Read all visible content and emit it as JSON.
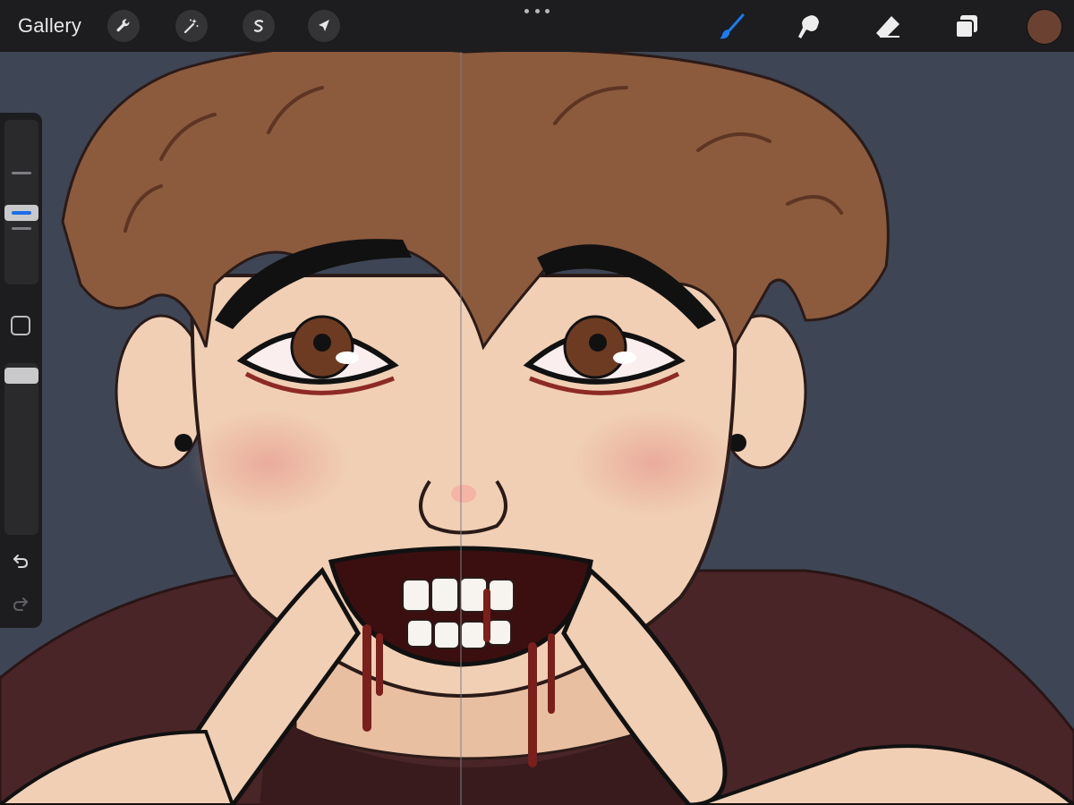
{
  "app": {
    "gallery_label": "Gallery"
  },
  "toolbar": {
    "left_tools": [
      {
        "name": "actions",
        "icon": "wrench-icon"
      },
      {
        "name": "adjustments",
        "icon": "magic-wand-icon"
      },
      {
        "name": "selection",
        "icon": "selection-s-icon"
      },
      {
        "name": "transform",
        "icon": "arrow-cursor-icon"
      }
    ],
    "more_icon": "more-dots-icon",
    "right_tools": [
      {
        "name": "brush",
        "icon": "brush-icon",
        "active": true
      },
      {
        "name": "smudge",
        "icon": "smudge-icon",
        "active": false
      },
      {
        "name": "eraser",
        "icon": "eraser-icon",
        "active": false
      },
      {
        "name": "layers",
        "icon": "layers-icon",
        "active": false
      }
    ],
    "current_color": "#6b4232",
    "active_tool_color": "#1a7cf0"
  },
  "sidebar": {
    "brush_size_level": 0.43,
    "brush_opacity_level": 0.97,
    "icons": [
      "modify-square-icon",
      "undo-icon",
      "redo-icon"
    ]
  },
  "canvas": {
    "background_color": "#3e4655",
    "shirt_color": "#4a2527",
    "skin_color": "#f0cfb4",
    "hair_color": "#8c5a3c",
    "symmetry_guide": true
  }
}
